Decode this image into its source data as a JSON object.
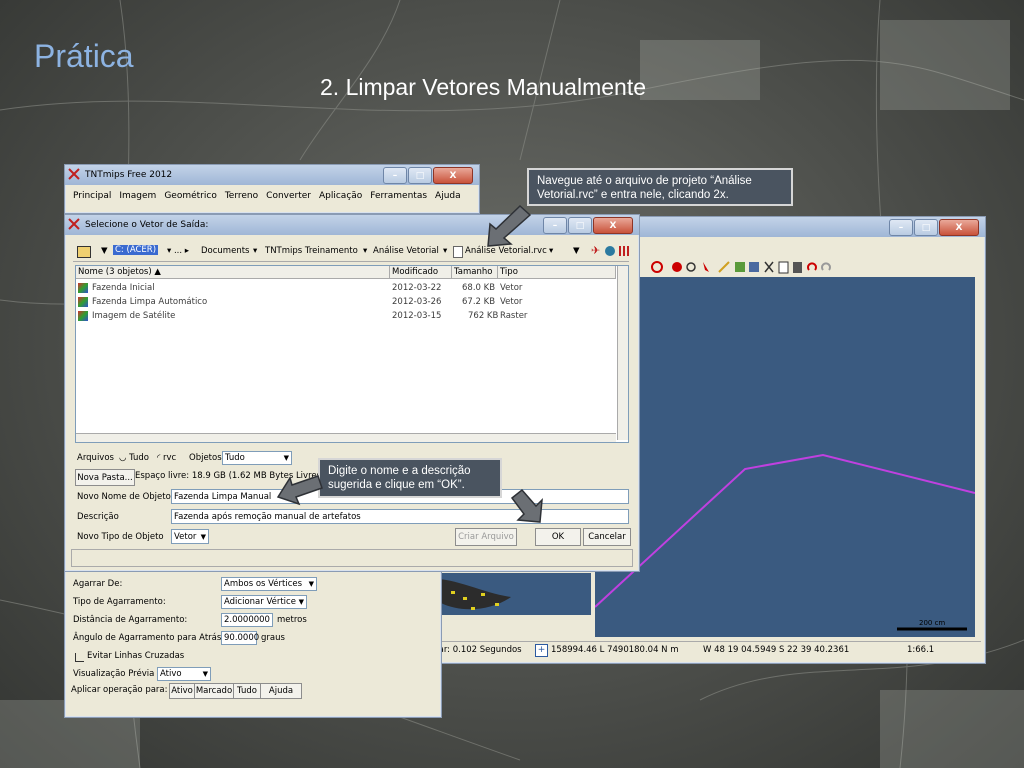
{
  "slide": {
    "title": "Prática",
    "subtitle": "2. Limpar Vetores Manualmente"
  },
  "main_window": {
    "title": "TNTmips Free 2012",
    "menu": [
      "Principal",
      "Imagem",
      "Geométrico",
      "Terreno",
      "Converter",
      "Aplicação",
      "Ferramentas",
      "Ajuda"
    ]
  },
  "dialog": {
    "title": "Selecione o Vetor de Saída:",
    "path": [
      "C: (ACER)",
      "...",
      "Documents",
      "TNTmips Treinamento",
      "Análise Vetorial",
      "Análise Vetorial.rvc"
    ],
    "columns": {
      "name": "Nome  (3 objetos)",
      "modified": "Modificado",
      "size": "Tamanho",
      "type": "Tipo"
    },
    "files": [
      {
        "name": "Fazenda Inicial",
        "modified": "2012-03-22",
        "size": "68.0 KB",
        "type": "Vetor"
      },
      {
        "name": "Fazenda Limpa Automático",
        "modified": "2012-03-26",
        "size": "67.2 KB",
        "type": "Vetor"
      },
      {
        "name": "Imagem de Satélite",
        "modified": "2012-03-15",
        "size": "762 KB",
        "type": "Raster"
      }
    ],
    "files_label": "Arquivos",
    "radio_all": "Tudo",
    "radio_rvc": "rvc",
    "objects_label": "Objetos",
    "objects_value": "Tudo",
    "new_folder": "Nova Pasta...",
    "free_space": "Espaço livre: 18.9 GB  (1.62 MB Bytes Livres)",
    "new_name_label": "Novo Nome de Objeto",
    "new_name_value": "Fazenda Limpa Manual",
    "description_label": "Descrição",
    "description_value": "Fazenda após remoção manual de artefatos",
    "new_type_label": "Novo Tipo de Objeto",
    "new_type_value": "Vetor",
    "create_file": "Criar Arquivo",
    "ok": "OK",
    "cancel": "Cancelar"
  },
  "tool_panel": {
    "grab_from_label": "Agarrar De:",
    "grab_from_value": "Ambos os Vértices",
    "grab_type_label": "Tipo de Agarramento:",
    "grab_type_value": "Adicionar Vértice",
    "grab_dist_label": "Distância de Agarramento:",
    "grab_dist_value": "2.0000000",
    "grab_dist_unit": "metros",
    "grab_angle_label": "Ângulo de Agarramento para Atrás:",
    "grab_angle_value": "90.0000",
    "grab_angle_unit": "graus",
    "avoid_crossed": "Evitar Linhas Cruzadas",
    "preview_label": "Visualização Prévia",
    "preview_value": "Ativo",
    "apply_label": "Aplicar operação para:",
    "apply_options": [
      "Ativo",
      "Marcado",
      "Tudo"
    ],
    "help": "Ajuda"
  },
  "view_window": {
    "draw_time": "Tempo para desenhar: 0.102 Segundos",
    "coords": "158994.46 L  7490180.04 N m",
    "latlon": "W 48 19 04.5949  S 22 39 40.2361",
    "scale": "1:66.1",
    "scalebar": "200 cm"
  },
  "callouts": {
    "top": "Navegue até o arquivo de projeto “Análise Vetorial.rvc” e entra nele, clicando 2x.",
    "middle": "Digite o nome e a descrição sugerida e clique em “OK”."
  },
  "colors": {
    "title": "#8db3e2",
    "callout_bg": "#4a5460",
    "map_bg": "#3a5a80",
    "vector_line": "#c040e0"
  }
}
